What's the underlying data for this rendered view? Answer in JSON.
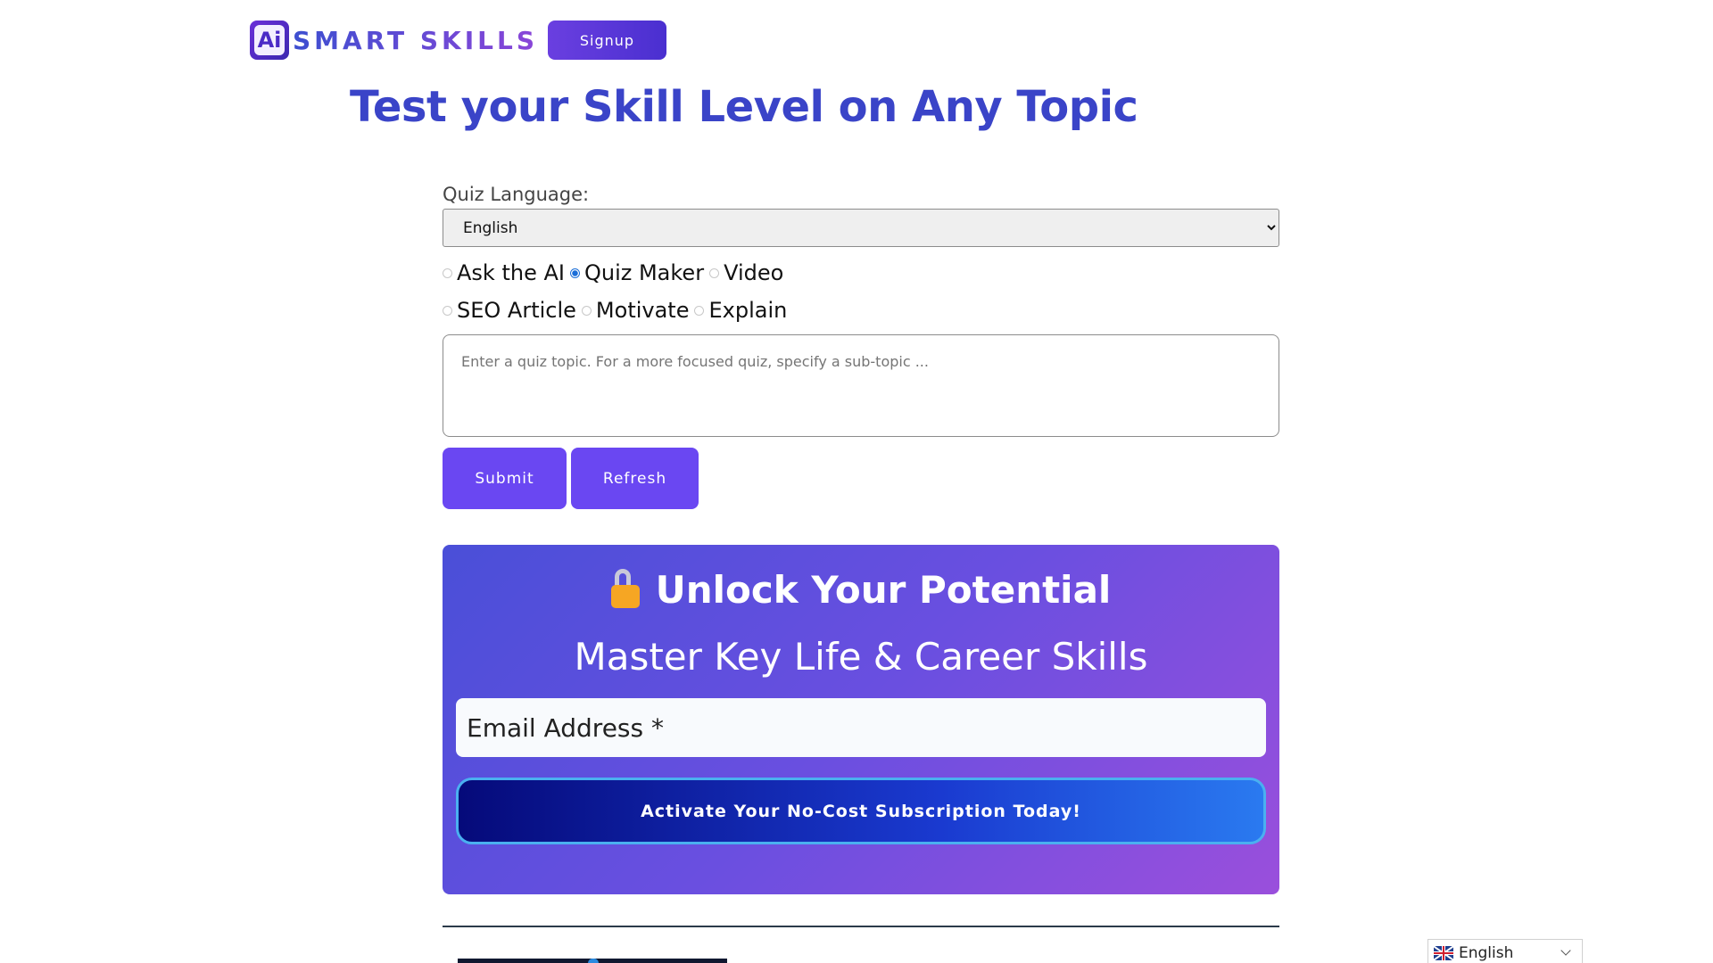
{
  "header": {
    "logo_badge": "Ai",
    "logo_text": "SMART SKILLS",
    "signup_label": "Signup"
  },
  "main": {
    "title": "Test your Skill Level on Any Topic"
  },
  "form": {
    "language_label": "Quiz Language:",
    "language_value": "English",
    "modes_row1": [
      {
        "label": "Ask the AI",
        "checked": false
      },
      {
        "label": "Quiz Maker",
        "checked": true
      },
      {
        "label": "Video",
        "checked": false
      }
    ],
    "modes_row2": [
      {
        "label": "SEO Article",
        "checked": false
      },
      {
        "label": "Motivate",
        "checked": false
      },
      {
        "label": "Explain",
        "checked": false
      }
    ],
    "topic_placeholder": "Enter a quiz topic. For a more focused quiz, specify a sub-topic ...",
    "submit_label": "Submit",
    "refresh_label": "Refresh"
  },
  "promo": {
    "title": "Unlock Your Potential",
    "subtitle": "Master Key Life & Career Skills",
    "email_placeholder": "Email Address *",
    "cta_label": "Activate Your No-Cost Subscription Today!",
    "colors": {
      "gradient_start": "#4a4fd8",
      "gradient_end": "#9a4fdc",
      "cta_start": "#050a7a",
      "cta_end": "#2a7af0"
    }
  },
  "language_widget": {
    "label": "English",
    "flag": "uk-flag-icon"
  },
  "colors": {
    "title": "#3a44c8",
    "button": "#6a47f2"
  }
}
